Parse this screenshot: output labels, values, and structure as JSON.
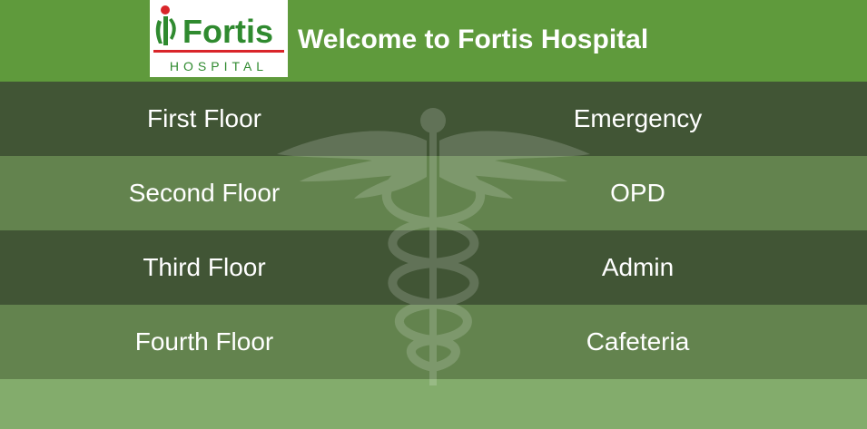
{
  "header": {
    "logo_text": "Fortis",
    "logo_subtext": "HOSPITAL",
    "title": "Welcome to Fortis Hospital",
    "background_color": "#5f9a3c"
  },
  "rows": [
    {
      "left": "First Floor",
      "right": "Emergency"
    },
    {
      "left": "Second Floor",
      "right": "OPD"
    },
    {
      "left": "Third Floor",
      "right": "Admin"
    },
    {
      "left": "Fourth Floor",
      "right": "Cafeteria"
    }
  ],
  "colors": {
    "row_dark": "#415535",
    "row_light": "#63834e",
    "footer": "#83ac6c",
    "logo_green": "#2f8a2f",
    "logo_red": "#d9252a"
  },
  "watermark_icon": "caduceus-icon"
}
